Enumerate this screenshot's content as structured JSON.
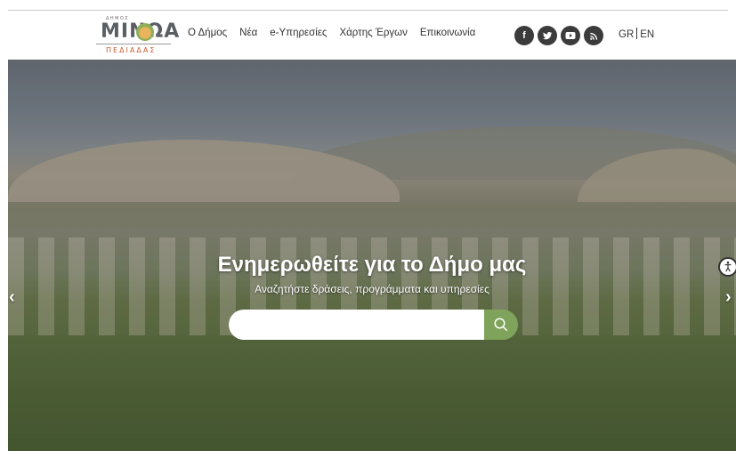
{
  "logo": {
    "top_text": "ΔΗΜΟΣ",
    "main_text": "ΜΙΝΩΑ",
    "sub_text": "ΠΕΔΙΑΔΑΣ"
  },
  "nav": {
    "items": [
      {
        "label": "Ο Δήμος"
      },
      {
        "label": "Νέα"
      },
      {
        "label": "e-Υπηρεσίες"
      },
      {
        "label": "Χάρτης Έργων"
      },
      {
        "label": "Επικοινωνία"
      }
    ]
  },
  "social": [
    {
      "icon": "facebook-icon",
      "glyph": "f"
    },
    {
      "icon": "twitter-icon",
      "glyph": "t"
    },
    {
      "icon": "youtube-icon",
      "glyph": "▶"
    },
    {
      "icon": "rss-icon",
      "glyph": "◉"
    }
  ],
  "lang": {
    "gr": "GR",
    "en": "EN"
  },
  "hero": {
    "title": "Ενημερωθείτε για το Δήμο μας",
    "subtitle": "Αναζητήστε δράσεις, προγράμματα και υπηρεσίες",
    "search_placeholder": ""
  },
  "colors": {
    "accent": "#7fa35a",
    "social_bg": "#3b3b3b",
    "brand_orange": "#c45a2a"
  }
}
